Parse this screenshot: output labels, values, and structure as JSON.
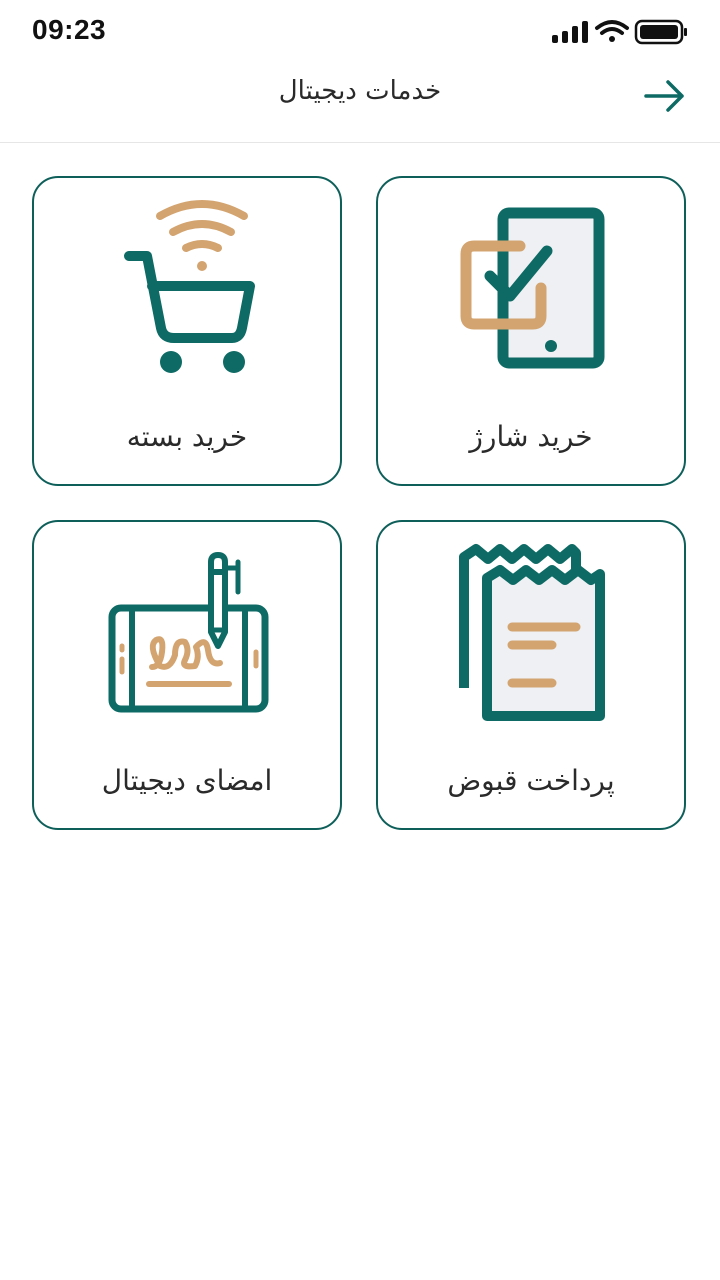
{
  "status_bar": {
    "time": "09:23",
    "icons": [
      "signal-icon",
      "wifi-icon",
      "battery-icon"
    ]
  },
  "header": {
    "title": "خدمات دیجیتال",
    "back_icon": "arrow-right-icon"
  },
  "colors": {
    "primary": "#0e6a64",
    "accent": "#d3a470",
    "border": "#0e5f5a",
    "fill_light": "#eef0f4"
  },
  "services": [
    {
      "label": "خرید شارژ",
      "icon": "mobile-charge-icon"
    },
    {
      "label": "خرید بسته",
      "icon": "cart-wifi-icon"
    },
    {
      "label": "پرداخت قبوض",
      "icon": "bill-receipt-icon"
    },
    {
      "label": "امضای دیجیتال",
      "icon": "digital-signature-icon"
    }
  ]
}
